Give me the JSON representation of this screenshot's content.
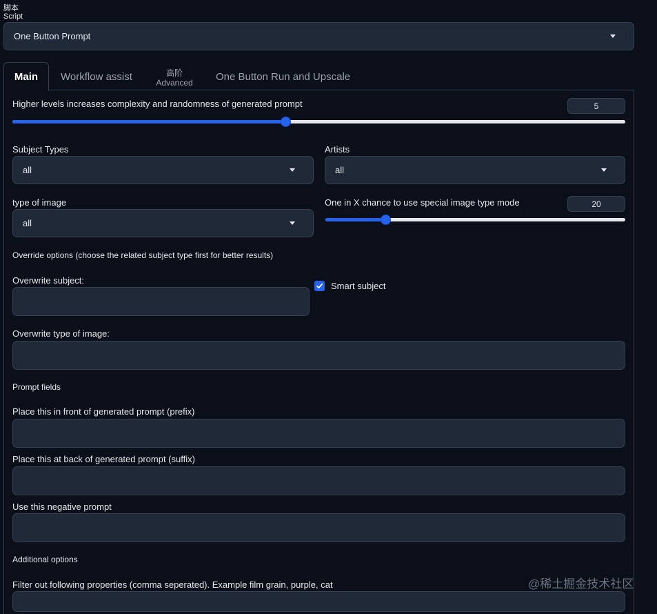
{
  "script": {
    "label_cn": "脚本",
    "label_en": "Script",
    "selected": "One Button Prompt"
  },
  "tabs": {
    "main": "Main",
    "workflow": "Workflow assist",
    "advanced_cn": "高阶",
    "advanced_en": "Advanced",
    "run_upscale": "One Button Run and Upscale"
  },
  "complexity": {
    "label": "Higher levels increases complexity and randomness of generated prompt",
    "value": "5",
    "fraction": 0.45
  },
  "subject_types": {
    "label": "Subject Types",
    "selected": "all"
  },
  "artists": {
    "label": "Artists",
    "selected": "all"
  },
  "image_type": {
    "label": "type of image",
    "selected": "all"
  },
  "special_mode": {
    "label": "One in X chance to use special image type mode",
    "value": "20",
    "fraction": 0.2
  },
  "override_heading": "Override options (choose the related subject type first for better results)",
  "overwrite_subject": {
    "label": "Overwrite subject:",
    "value": ""
  },
  "smart_subject": {
    "label": "Smart subject",
    "checked": true
  },
  "overwrite_type": {
    "label": "Overwrite type of image:",
    "value": ""
  },
  "prompt_fields_heading": "Prompt fields",
  "prefix": {
    "label": "Place this in front of generated prompt (prefix)",
    "value": ""
  },
  "suffix": {
    "label": "Place this at back of generated prompt (suffix)",
    "value": ""
  },
  "negative": {
    "label": "Use this negative prompt",
    "value": ""
  },
  "additional_heading": "Additional options",
  "filter": {
    "label": "Filter out following properties (comma seperated). Example film grain, purple, cat",
    "value": ""
  },
  "watermark": "@稀土掘金技术社区",
  "colors": {
    "accent": "#2563eb",
    "background": "#0b0f19",
    "input": "#1f2937",
    "border": "#374151"
  }
}
